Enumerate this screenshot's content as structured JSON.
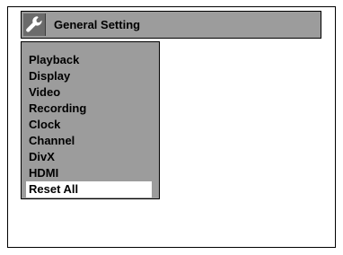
{
  "header": {
    "icon": "wrench-icon",
    "title": "General Setting"
  },
  "menu": {
    "items": [
      {
        "label": "Playback",
        "selected": false
      },
      {
        "label": "Display",
        "selected": false
      },
      {
        "label": "Video",
        "selected": false
      },
      {
        "label": "Recording",
        "selected": false
      },
      {
        "label": "Clock",
        "selected": false
      },
      {
        "label": "Channel",
        "selected": false
      },
      {
        "label": "DivX",
        "selected": false
      },
      {
        "label": "HDMI",
        "selected": false
      },
      {
        "label": "Reset All",
        "selected": true
      }
    ]
  },
  "colors": {
    "panel": "#9c9c9c",
    "icon_bg": "#6b6b6b",
    "highlight": "#ffffff",
    "border": "#000000"
  }
}
